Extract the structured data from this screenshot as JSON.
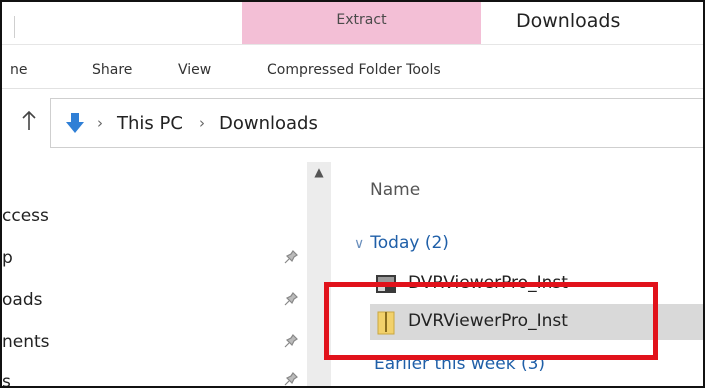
{
  "ribbon": {
    "context_header": "Extract",
    "window_title": "Downloads",
    "tabs": [
      "ne",
      "Share",
      "View",
      "Compressed Folder Tools"
    ]
  },
  "address": {
    "crumbs": [
      "This PC",
      "Downloads"
    ]
  },
  "nav": {
    "items": [
      "ccess",
      "p",
      "oads",
      "nents",
      "s"
    ]
  },
  "files": {
    "column_header": "Name",
    "group_label": "Today (2)",
    "rows": [
      {
        "name": "DVRViewerPro_Inst",
        "icon": "installer-icon"
      },
      {
        "name": "DVRViewerPro_Inst",
        "icon": "zip-folder-icon",
        "selected": true
      }
    ],
    "earlier_group_label": "Earlier this week (3)"
  },
  "colors": {
    "context_tab": "#f3bfd6",
    "highlight": "#e1121b",
    "selection": "#d9d9d9",
    "group_text": "#1f5fa8"
  }
}
